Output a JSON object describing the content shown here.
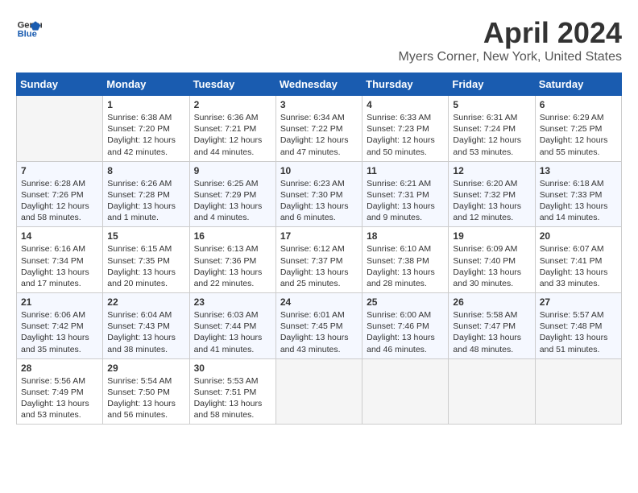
{
  "logo": {
    "line1": "General",
    "line2": "Blue"
  },
  "title": "April 2024",
  "subtitle": "Myers Corner, New York, United States",
  "weekdays": [
    "Sunday",
    "Monday",
    "Tuesday",
    "Wednesday",
    "Thursday",
    "Friday",
    "Saturday"
  ],
  "weeks": [
    [
      {
        "day": "",
        "info": ""
      },
      {
        "day": "1",
        "info": "Sunrise: 6:38 AM\nSunset: 7:20 PM\nDaylight: 12 hours\nand 42 minutes."
      },
      {
        "day": "2",
        "info": "Sunrise: 6:36 AM\nSunset: 7:21 PM\nDaylight: 12 hours\nand 44 minutes."
      },
      {
        "day": "3",
        "info": "Sunrise: 6:34 AM\nSunset: 7:22 PM\nDaylight: 12 hours\nand 47 minutes."
      },
      {
        "day": "4",
        "info": "Sunrise: 6:33 AM\nSunset: 7:23 PM\nDaylight: 12 hours\nand 50 minutes."
      },
      {
        "day": "5",
        "info": "Sunrise: 6:31 AM\nSunset: 7:24 PM\nDaylight: 12 hours\nand 53 minutes."
      },
      {
        "day": "6",
        "info": "Sunrise: 6:29 AM\nSunset: 7:25 PM\nDaylight: 12 hours\nand 55 minutes."
      }
    ],
    [
      {
        "day": "7",
        "info": "Sunrise: 6:28 AM\nSunset: 7:26 PM\nDaylight: 12 hours\nand 58 minutes."
      },
      {
        "day": "8",
        "info": "Sunrise: 6:26 AM\nSunset: 7:28 PM\nDaylight: 13 hours\nand 1 minute."
      },
      {
        "day": "9",
        "info": "Sunrise: 6:25 AM\nSunset: 7:29 PM\nDaylight: 13 hours\nand 4 minutes."
      },
      {
        "day": "10",
        "info": "Sunrise: 6:23 AM\nSunset: 7:30 PM\nDaylight: 13 hours\nand 6 minutes."
      },
      {
        "day": "11",
        "info": "Sunrise: 6:21 AM\nSunset: 7:31 PM\nDaylight: 13 hours\nand 9 minutes."
      },
      {
        "day": "12",
        "info": "Sunrise: 6:20 AM\nSunset: 7:32 PM\nDaylight: 13 hours\nand 12 minutes."
      },
      {
        "day": "13",
        "info": "Sunrise: 6:18 AM\nSunset: 7:33 PM\nDaylight: 13 hours\nand 14 minutes."
      }
    ],
    [
      {
        "day": "14",
        "info": "Sunrise: 6:16 AM\nSunset: 7:34 PM\nDaylight: 13 hours\nand 17 minutes."
      },
      {
        "day": "15",
        "info": "Sunrise: 6:15 AM\nSunset: 7:35 PM\nDaylight: 13 hours\nand 20 minutes."
      },
      {
        "day": "16",
        "info": "Sunrise: 6:13 AM\nSunset: 7:36 PM\nDaylight: 13 hours\nand 22 minutes."
      },
      {
        "day": "17",
        "info": "Sunrise: 6:12 AM\nSunset: 7:37 PM\nDaylight: 13 hours\nand 25 minutes."
      },
      {
        "day": "18",
        "info": "Sunrise: 6:10 AM\nSunset: 7:38 PM\nDaylight: 13 hours\nand 28 minutes."
      },
      {
        "day": "19",
        "info": "Sunrise: 6:09 AM\nSunset: 7:40 PM\nDaylight: 13 hours\nand 30 minutes."
      },
      {
        "day": "20",
        "info": "Sunrise: 6:07 AM\nSunset: 7:41 PM\nDaylight: 13 hours\nand 33 minutes."
      }
    ],
    [
      {
        "day": "21",
        "info": "Sunrise: 6:06 AM\nSunset: 7:42 PM\nDaylight: 13 hours\nand 35 minutes."
      },
      {
        "day": "22",
        "info": "Sunrise: 6:04 AM\nSunset: 7:43 PM\nDaylight: 13 hours\nand 38 minutes."
      },
      {
        "day": "23",
        "info": "Sunrise: 6:03 AM\nSunset: 7:44 PM\nDaylight: 13 hours\nand 41 minutes."
      },
      {
        "day": "24",
        "info": "Sunrise: 6:01 AM\nSunset: 7:45 PM\nDaylight: 13 hours\nand 43 minutes."
      },
      {
        "day": "25",
        "info": "Sunrise: 6:00 AM\nSunset: 7:46 PM\nDaylight: 13 hours\nand 46 minutes."
      },
      {
        "day": "26",
        "info": "Sunrise: 5:58 AM\nSunset: 7:47 PM\nDaylight: 13 hours\nand 48 minutes."
      },
      {
        "day": "27",
        "info": "Sunrise: 5:57 AM\nSunset: 7:48 PM\nDaylight: 13 hours\nand 51 minutes."
      }
    ],
    [
      {
        "day": "28",
        "info": "Sunrise: 5:56 AM\nSunset: 7:49 PM\nDaylight: 13 hours\nand 53 minutes."
      },
      {
        "day": "29",
        "info": "Sunrise: 5:54 AM\nSunset: 7:50 PM\nDaylight: 13 hours\nand 56 minutes."
      },
      {
        "day": "30",
        "info": "Sunrise: 5:53 AM\nSunset: 7:51 PM\nDaylight: 13 hours\nand 58 minutes."
      },
      {
        "day": "",
        "info": ""
      },
      {
        "day": "",
        "info": ""
      },
      {
        "day": "",
        "info": ""
      },
      {
        "day": "",
        "info": ""
      }
    ]
  ]
}
